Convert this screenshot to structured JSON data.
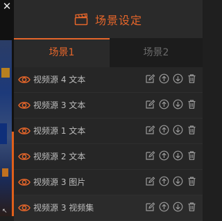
{
  "window": {
    "close_glyph": "✕"
  },
  "header": {
    "title": "场景设定",
    "icon": "clapperboard-icon"
  },
  "tabs": [
    {
      "label": "场景1",
      "active": true
    },
    {
      "label": "场景2",
      "active": false
    }
  ],
  "sources": [
    {
      "label": "视频源 4 文本"
    },
    {
      "label": "视频源 3 文本"
    },
    {
      "label": "视频源 1 文本"
    },
    {
      "label": "视频源 2 文本"
    },
    {
      "label": "视频源 3 图片"
    },
    {
      "label": "视频源 3 视频集"
    }
  ],
  "colors": {
    "accent": "#e6662a",
    "panel_bg": "#262626",
    "text": "#bdbdbd",
    "icon": "#9a9a9a"
  }
}
